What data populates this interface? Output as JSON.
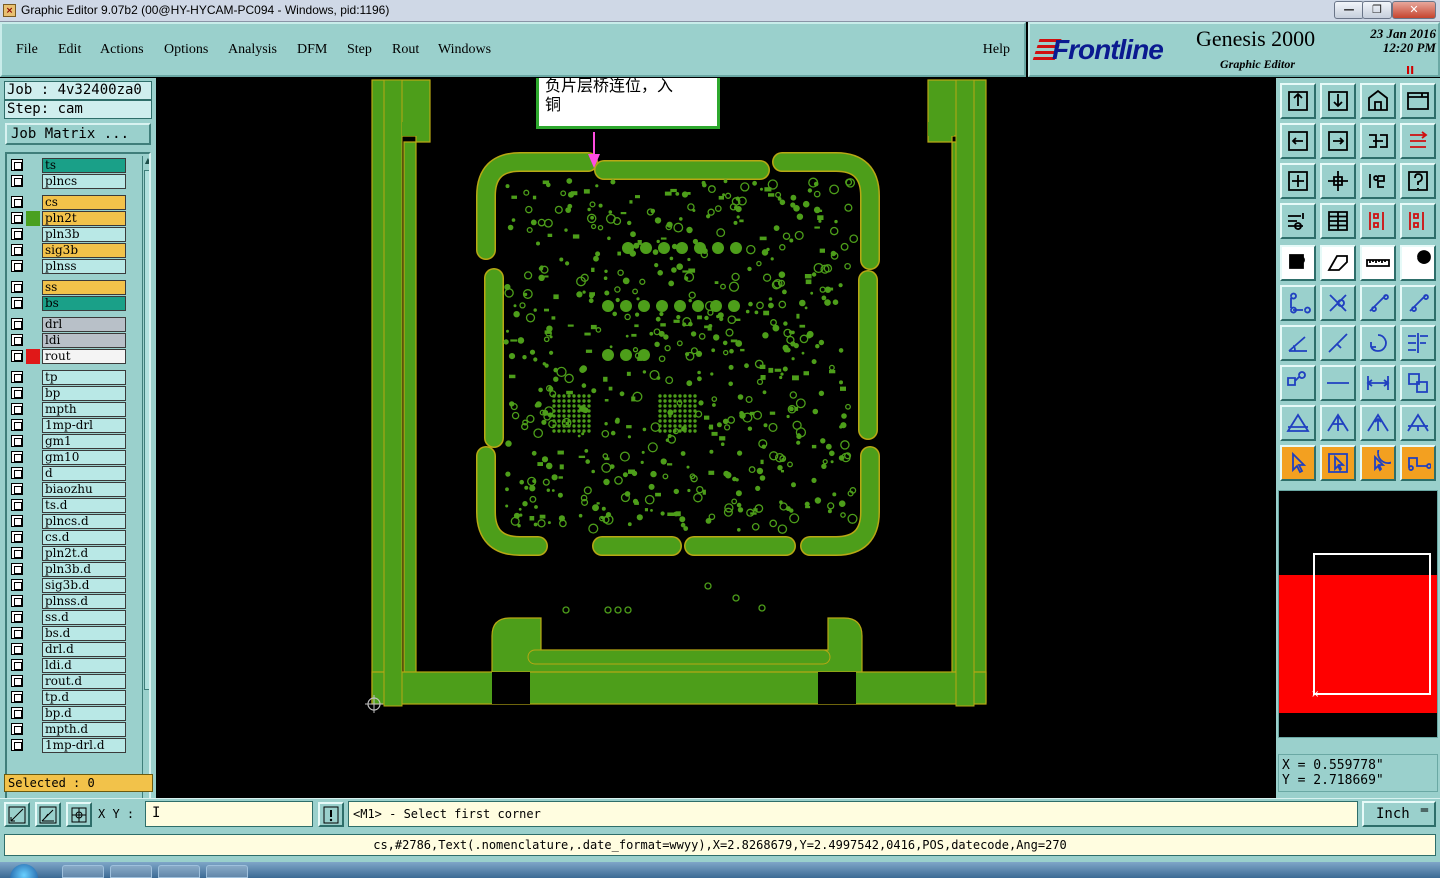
{
  "window": {
    "title": "Graphic Editor 9.07b2 (00@HY-HYCAM-PC094 - Windows, pid:1196)",
    "min_glyph": "—",
    "max_glyph": "❐",
    "close_glyph": "✕"
  },
  "menu": {
    "file": "File",
    "edit": "Edit",
    "actions": "Actions",
    "options": "Options",
    "analysis": "Analysis",
    "dfm": "DFM",
    "step": "Step",
    "rout": "Rout",
    "windows": "Windows",
    "help": "Help"
  },
  "logo": {
    "brand": "Frontline",
    "product": "Genesis 2000",
    "subtitle": "Graphic Editor",
    "date": "23 Jan 2016",
    "time": "12:20 PM",
    "indicator": "II"
  },
  "job": {
    "job_line": "Job : 4v32400za0",
    "step_line": "Step: cam",
    "matrix_button": "Job Matrix ..."
  },
  "layers": [
    {
      "name": "ts",
      "kind": "mask",
      "swatch": ""
    },
    {
      "name": "plncs",
      "kind": "board",
      "swatch": ""
    },
    {
      "name": "cs",
      "kind": "sig",
      "swatch": ""
    },
    {
      "name": "pln2t",
      "kind": "sig",
      "swatch": "#4aa020"
    },
    {
      "name": "pln3b",
      "kind": "board",
      "swatch": ""
    },
    {
      "name": "sig3b",
      "kind": "sig",
      "swatch": ""
    },
    {
      "name": "plnss",
      "kind": "board",
      "swatch": ""
    },
    {
      "name": "ss",
      "kind": "sig",
      "swatch": ""
    },
    {
      "name": "bs",
      "kind": "mask",
      "swatch": ""
    },
    {
      "name": "drl",
      "kind": "drill",
      "swatch": ""
    },
    {
      "name": "ldi",
      "kind": "drill",
      "swatch": ""
    },
    {
      "name": "rout",
      "kind": "rout",
      "swatch": "#e01818"
    },
    {
      "name": "tp",
      "kind": "doc",
      "swatch": ""
    },
    {
      "name": "bp",
      "kind": "doc",
      "swatch": ""
    },
    {
      "name": "mpth",
      "kind": "doc",
      "swatch": ""
    },
    {
      "name": "1mp-drl",
      "kind": "doc",
      "swatch": ""
    },
    {
      "name": "gm1",
      "kind": "doc",
      "swatch": ""
    },
    {
      "name": "gm10",
      "kind": "doc",
      "swatch": ""
    },
    {
      "name": "d",
      "kind": "doc",
      "swatch": ""
    },
    {
      "name": "biaozhu",
      "kind": "doc",
      "swatch": ""
    },
    {
      "name": "ts.d",
      "kind": "doc",
      "swatch": ""
    },
    {
      "name": "plncs.d",
      "kind": "doc",
      "swatch": ""
    },
    {
      "name": "cs.d",
      "kind": "doc",
      "swatch": ""
    },
    {
      "name": "pln2t.d",
      "kind": "doc",
      "swatch": ""
    },
    {
      "name": "pln3b.d",
      "kind": "doc",
      "swatch": ""
    },
    {
      "name": "sig3b.d",
      "kind": "doc",
      "swatch": ""
    },
    {
      "name": "plnss.d",
      "kind": "doc",
      "swatch": ""
    },
    {
      "name": "ss.d",
      "kind": "doc",
      "swatch": ""
    },
    {
      "name": "bs.d",
      "kind": "doc",
      "swatch": ""
    },
    {
      "name": "drl.d",
      "kind": "doc",
      "swatch": ""
    },
    {
      "name": "ldi.d",
      "kind": "doc",
      "swatch": ""
    },
    {
      "name": "rout.d",
      "kind": "doc",
      "swatch": ""
    },
    {
      "name": "tp.d",
      "kind": "doc",
      "swatch": ""
    },
    {
      "name": "bp.d",
      "kind": "doc",
      "swatch": ""
    },
    {
      "name": "mpth.d",
      "kind": "doc",
      "swatch": ""
    },
    {
      "name": "1mp-drl.d",
      "kind": "doc",
      "swatch": ""
    }
  ],
  "selected": "Selected : 0",
  "annotation": {
    "line1": "负片层桥连位，入",
    "line2": "铜"
  },
  "coords": {
    "x": "X = 0.559778\"",
    "y": "Y = 2.718669\""
  },
  "command": {
    "xy_label": "X Y :",
    "xy_value": "",
    "prompt": "<M1> - Select first corner",
    "unit": "Inch"
  },
  "status": "cs,#2786,Text(.nomenclature,.date_format=wwyy),X=2.8268679,Y=2.4997542,0416,POS,datecode,Ang=270",
  "colors": {
    "copper": "#4d9e1a",
    "copper_outline": "#b8a814",
    "panel": "#9ad0cc",
    "highlight_red": "#ff0000"
  },
  "tools": [
    "layer-up-icon",
    "layer-down-icon",
    "home-icon",
    "window-icon",
    "move-left-icon",
    "move-right-icon",
    "mirror-icon",
    "redo-icon",
    "zoom-fit-icon",
    "zoom-center-icon",
    "ratio-1-2-icon",
    "help-icon",
    "snap-icon",
    "grid-icon",
    "net-red-icon",
    "net-red2-icon",
    "feature-select-icon",
    "edit-shape-icon",
    "measure-ruler-icon",
    "pad-icon",
    "connect-icon",
    "delete-node-icon",
    "line-node-icon",
    "line-node2-icon",
    "angle-icon",
    "slope-icon",
    "arc-icon",
    "flip-icon",
    "copy-node-icon",
    "dash-line-icon",
    "resize-icon",
    "group-icon",
    "triangle-icon",
    "triangle-up-icon",
    "arrow-up-icon",
    "arrow-split-icon",
    "pointer-icon",
    "pointer-box-icon",
    "pointer-circle-icon",
    "route-icon"
  ]
}
